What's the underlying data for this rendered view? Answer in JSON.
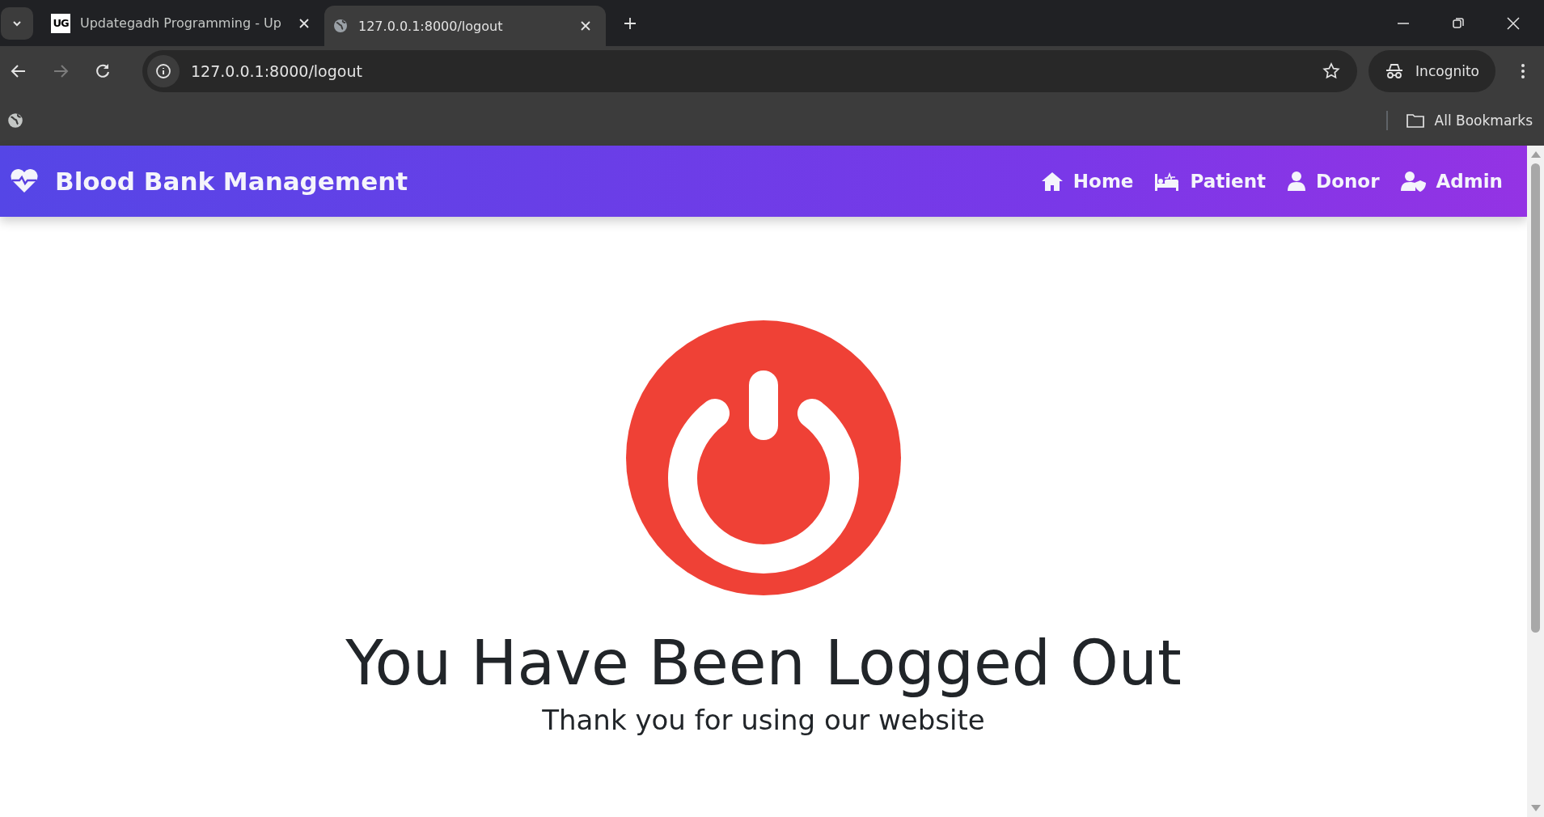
{
  "browser": {
    "tabs": [
      {
        "title": "Updategadh Programming - Up",
        "kind": "logo",
        "logo_text": "UG",
        "selected": false
      },
      {
        "title": "127.0.0.1:8000/logout",
        "kind": "globe",
        "selected": true
      }
    ],
    "address": "127.0.0.1:8000/logout",
    "profile": "Incognito",
    "bookmarks": "All Bookmarks"
  },
  "navbar": {
    "brand": "Blood Bank Management",
    "items": [
      {
        "label": "Home",
        "kind": "home"
      },
      {
        "label": "Patient",
        "kind": "bed"
      },
      {
        "label": "Donor",
        "kind": "user"
      },
      {
        "label": "Admin",
        "kind": "admin"
      }
    ]
  },
  "message": {
    "heading": "You Have Been Logged Out",
    "subtitle": "Thank you for using our website"
  }
}
